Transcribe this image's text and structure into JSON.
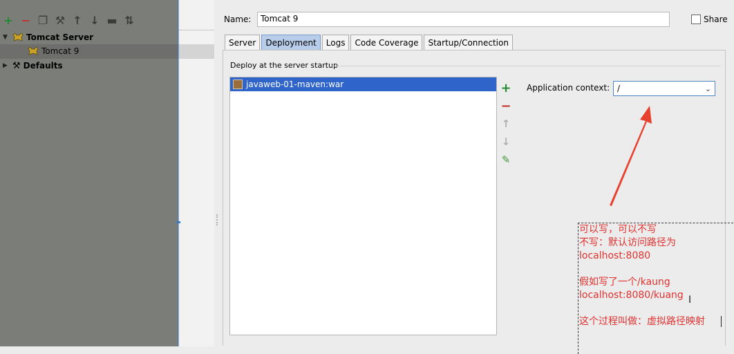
{
  "left": {
    "tree": [
      {
        "label": "Tomcat Server",
        "expanded": true,
        "bold": true
      },
      {
        "label": "Tomcat 9",
        "selected": true
      },
      {
        "label": "Defaults",
        "expanded": false,
        "bold": true
      }
    ],
    "toolbar_icons": [
      "add-icon",
      "remove-icon",
      "copy-icon",
      "wrench-icon",
      "arrow-up-icon",
      "arrow-down-icon",
      "folder-icon",
      "sort-icon"
    ]
  },
  "config": {
    "name_label": "Name:",
    "name_value": "Tomcat 9",
    "share_label": "Share",
    "share_checked": false
  },
  "tabs": [
    {
      "label": "Server",
      "active": false
    },
    {
      "label": "Deployment",
      "active": true
    },
    {
      "label": "Logs",
      "active": false
    },
    {
      "label": "Code Coverage",
      "active": false
    },
    {
      "label": "Startup/Connection",
      "active": false
    }
  ],
  "deployment": {
    "group_title": "Deploy at the server startup",
    "artifact": "javaweb-01-maven:war",
    "context_label": "Application context:",
    "context_value": "/"
  },
  "annotation": {
    "lines": [
      "可以写，可以不写",
      "不写：默认访问路径为",
      "localhost:8080",
      "假如写了一个/kaung",
      "localhost:8080/kuang",
      "这个过程叫做：虚拟路径映射"
    ],
    "color": "#e0322f"
  },
  "colors": {
    "selection": "#2f65ca",
    "active_tab": "#b8cde9",
    "arrow": "#e8402f"
  }
}
